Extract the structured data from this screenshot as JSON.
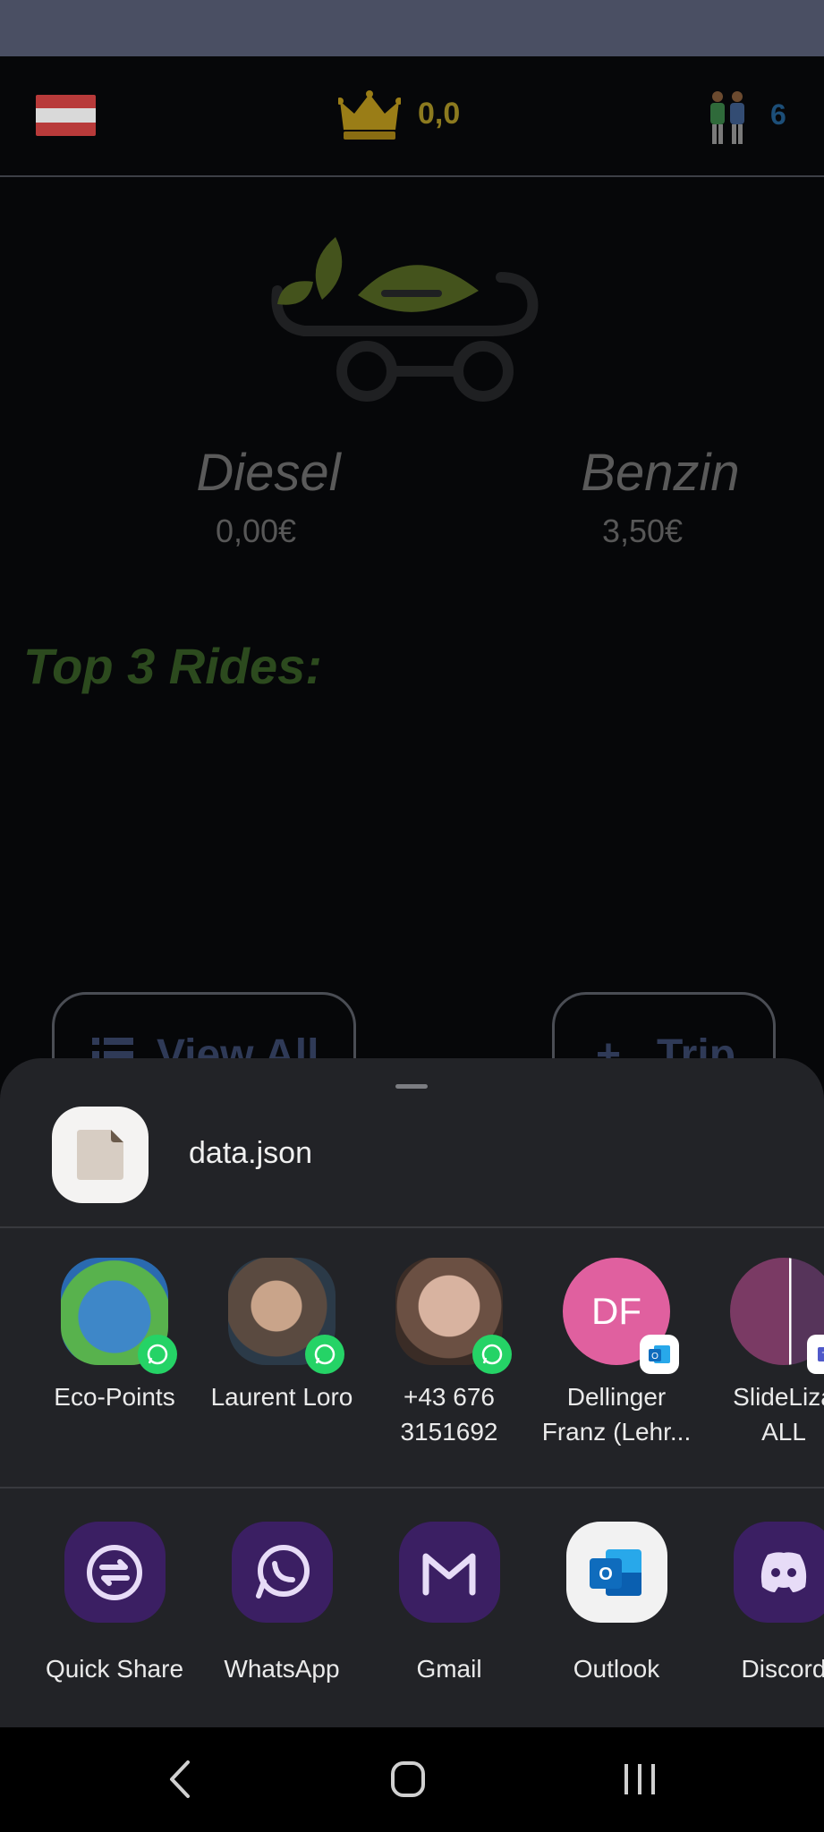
{
  "header": {
    "score": "0,0",
    "people_count": "6"
  },
  "fuel": [
    {
      "name": "Diesel",
      "price": "0,00€"
    },
    {
      "name": "Benzin",
      "price": "3,50€"
    }
  ],
  "rides_heading": "Top 3 Rides:",
  "buttons": {
    "view_all": "View All",
    "add_trip": "Trip"
  },
  "share_sheet": {
    "file_name": "data.json",
    "contacts": [
      {
        "label_line1": "Eco-Points",
        "label_line2": "",
        "badge": "whatsapp-icon"
      },
      {
        "label_line1": "Laurent Loro",
        "label_line2": "",
        "badge": "whatsapp-icon"
      },
      {
        "label_line1": "+43 676",
        "label_line2": "3151692",
        "badge": "whatsapp-icon"
      },
      {
        "label_line1": "Dellinger",
        "label_line2": "Franz (Lehr...",
        "initials": "DF",
        "badge": "outlook-icon"
      },
      {
        "label_line1": "SlideLiza",
        "label_line2": "ALL",
        "badge": "teams-icon"
      }
    ],
    "apps": [
      {
        "label": "Quick Share",
        "icon": "quick-share-icon"
      },
      {
        "label": "WhatsApp",
        "icon": "whatsapp-icon"
      },
      {
        "label": "Gmail",
        "icon": "gmail-icon"
      },
      {
        "label": "Outlook",
        "icon": "outlook-icon"
      },
      {
        "label": "Discord",
        "icon": "discord-icon"
      }
    ]
  },
  "colors": {
    "accent_purple": "#3b1f63",
    "avatar_pink": "#e0609f",
    "whatsapp_green": "#25d366",
    "outlook_blue": "#0f6cbd"
  }
}
